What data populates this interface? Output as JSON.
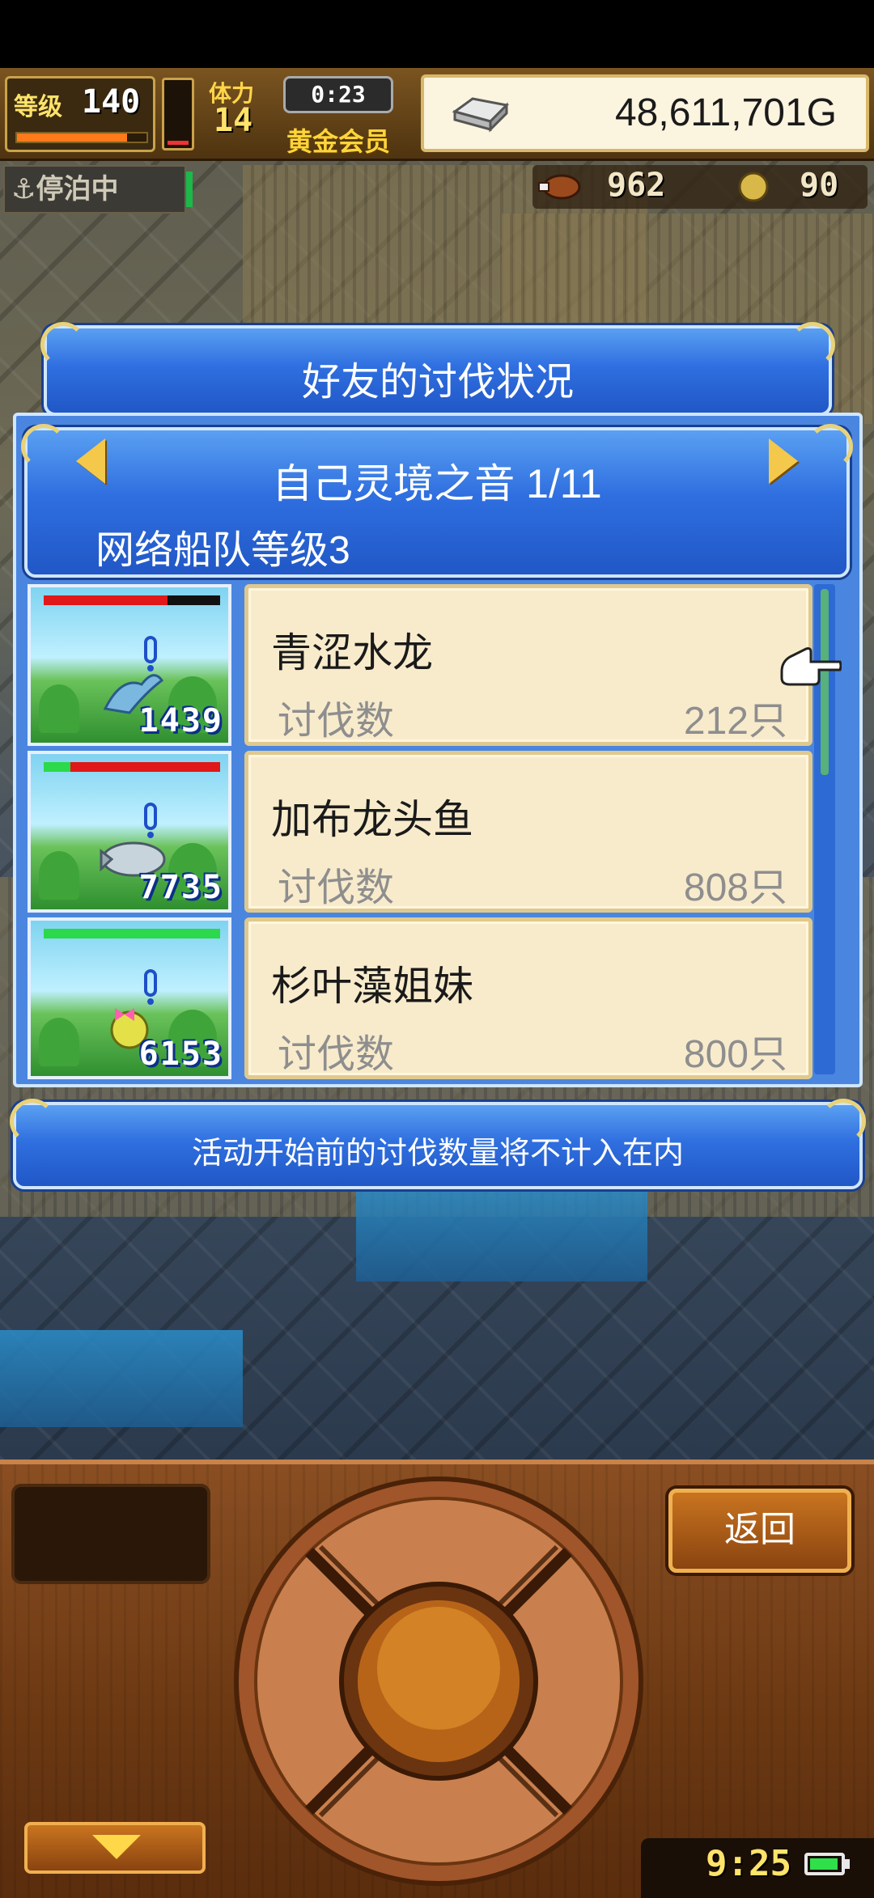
{
  "hud": {
    "level_label": "等级",
    "level_value": "140",
    "exp_fraction": 0.85,
    "stamina_fraction": 0.15,
    "stamina_label": "体力",
    "stamina_value": "14",
    "timer": "0:23",
    "membership": "黄金会员",
    "money": "48,611,701G",
    "dock_status": "停泊中",
    "resource_1": "962",
    "resource_2": "90"
  },
  "dialog": {
    "title": "好友的讨伐状况",
    "friend_name": "自己灵境之音 1/11",
    "fleet_level": "网络船队等级3",
    "rows": [
      {
        "monster": "青涩水龙",
        "kill_label": "讨伐数",
        "kill_count": "212只",
        "number": "1439",
        "hp_fraction": 0.0,
        "hp_red_fraction": 0.7
      },
      {
        "monster": "加布龙头鱼",
        "kill_label": "讨伐数",
        "kill_count": "808只",
        "number": "7735",
        "hp_fraction": 0.15,
        "hp_red_fraction": 0.85
      },
      {
        "monster": "杉叶藻姐妹",
        "kill_label": "讨伐数",
        "kill_count": "800只",
        "number": "6153",
        "hp_fraction": 1.0,
        "hp_red_fraction": 0.0
      }
    ],
    "note": "活动开始前的讨伐数量将不计入在内"
  },
  "controls": {
    "back_label": "返回",
    "clock": "9:25"
  },
  "colors": {
    "panel_blue": "#2f6fe0",
    "card_cream": "#f8ebcc",
    "hp_green": "#2bd94a",
    "hp_red": "#e01818"
  }
}
